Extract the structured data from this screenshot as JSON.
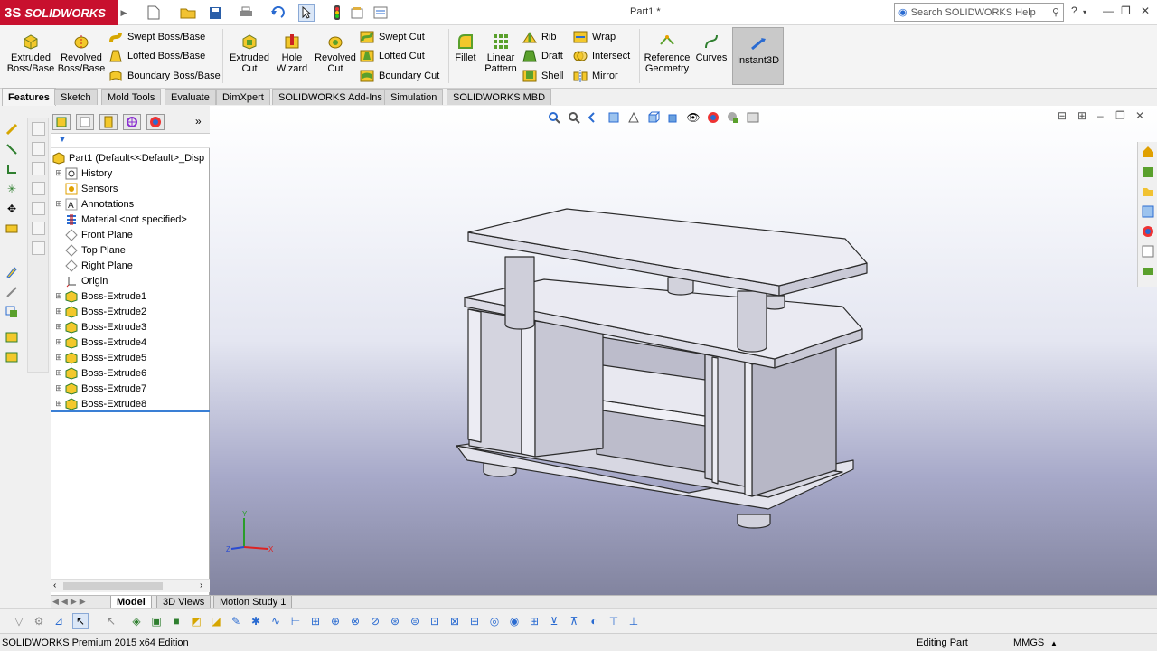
{
  "app": {
    "logo": "SOLIDWORKS",
    "logo_mark": "3S",
    "doc_title": "Part1 *"
  },
  "search": {
    "placeholder": "Search SOLIDWORKS Help"
  },
  "ribbon": {
    "extruded_boss": "Extruded\nBoss/Base",
    "revolved_boss": "Revolved\nBoss/Base",
    "swept_boss": "Swept Boss/Base",
    "lofted_boss": "Lofted Boss/Base",
    "boundary_boss": "Boundary Boss/Base",
    "extruded_cut": "Extruded\nCut",
    "hole_wizard": "Hole\nWizard",
    "revolved_cut": "Revolved\nCut",
    "swept_cut": "Swept Cut",
    "lofted_cut": "Lofted Cut",
    "boundary_cut": "Boundary Cut",
    "fillet": "Fillet",
    "linear_pattern": "Linear\nPattern",
    "rib": "Rib",
    "draft": "Draft",
    "shell": "Shell",
    "wrap": "Wrap",
    "intersect": "Intersect",
    "mirror": "Mirror",
    "reference_geometry": "Reference\nGeometry",
    "curves": "Curves",
    "instant3d": "Instant3D"
  },
  "tabs": [
    "Features",
    "Sketch",
    "Mold Tools",
    "Evaluate",
    "DimXpert",
    "SOLIDWORKS Add-Ins",
    "Simulation",
    "SOLIDWORKS MBD"
  ],
  "tree": {
    "root": "Part1  (Default<<Default>_Disp",
    "items": [
      "History",
      "Sensors",
      "Annotations",
      "Material <not specified>",
      "Front Plane",
      "Top Plane",
      "Right Plane",
      "Origin",
      "Boss-Extrude1",
      "Boss-Extrude2",
      "Boss-Extrude3",
      "Boss-Extrude4",
      "Boss-Extrude5",
      "Boss-Extrude6",
      "Boss-Extrude7",
      "Boss-Extrude8"
    ]
  },
  "bottom_tabs": [
    "Model",
    "3D Views",
    "Motion Study 1"
  ],
  "status": {
    "edition": "SOLIDWORKS Premium 2015 x64 Edition",
    "mode": "Editing Part",
    "units": "MMGS"
  },
  "colors": {
    "accent_red": "#c8102e",
    "model_face": "#e7e7ef",
    "model_shadow": "#a9a9b6"
  }
}
